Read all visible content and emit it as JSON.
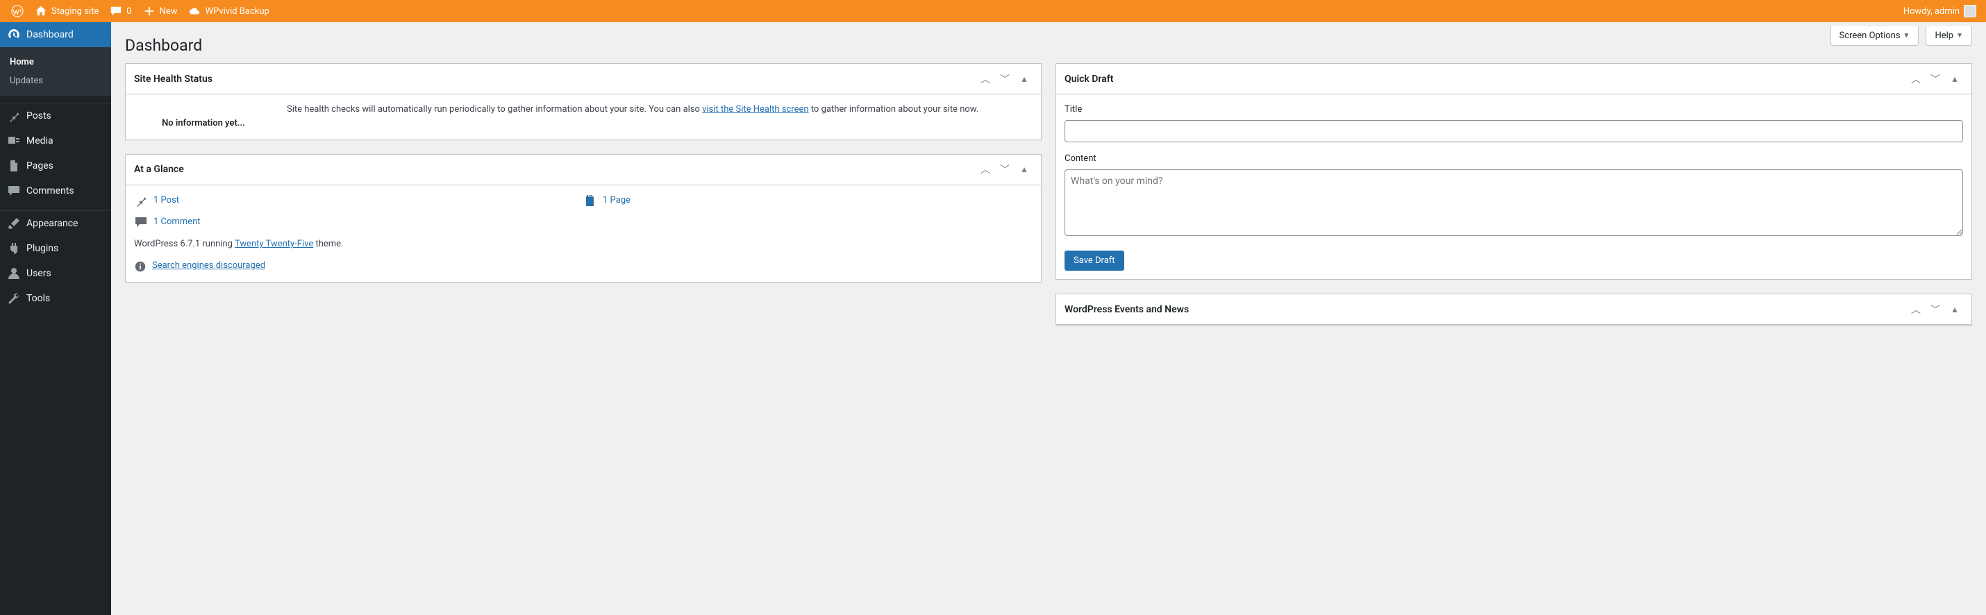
{
  "adminbar": {
    "site_name": "Staging site",
    "comments_count": "0",
    "new_label": "New",
    "wpvivid_label": "WPvivid Backup",
    "howdy": "Howdy, admin"
  },
  "sidebar": {
    "dashboard": "Dashboard",
    "home": "Home",
    "updates": "Updates",
    "posts": "Posts",
    "media": "Media",
    "pages": "Pages",
    "comments": "Comments",
    "appearance": "Appearance",
    "plugins": "Plugins",
    "users": "Users",
    "tools": "Tools"
  },
  "screen_options": "Screen Options",
  "help": "Help",
  "page_title": "Dashboard",
  "site_health": {
    "title": "Site Health Status",
    "no_info": "No information yet...",
    "body_pre": "Site health checks will automatically run periodically to gather information about your site. You can also ",
    "link": "visit the Site Health screen",
    "body_post": " to gather information about your site now."
  },
  "glance": {
    "title": "At a Glance",
    "posts": "1 Post",
    "comments": "1 Comment",
    "pages": "1 Page",
    "wp_pre": "WordPress 6.7.1 running ",
    "theme": "Twenty Twenty-Five",
    "wp_post": " theme.",
    "seo": "Search engines discouraged"
  },
  "quickdraft": {
    "title": "Quick Draft",
    "title_label": "Title",
    "content_label": "Content",
    "placeholder": "What's on your mind?",
    "save": "Save Draft"
  },
  "events": {
    "title": "WordPress Events and News"
  }
}
